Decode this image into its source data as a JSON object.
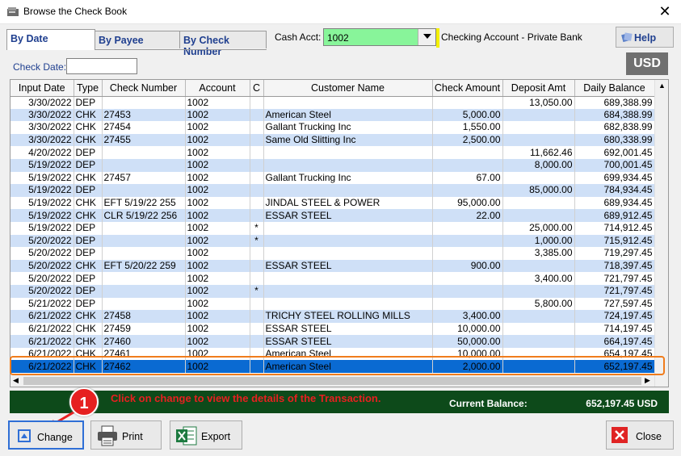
{
  "window": {
    "title": "Browse the Check Book",
    "close_glyph": "✕"
  },
  "tabs": [
    {
      "label": "By Date",
      "active": true
    },
    {
      "label": "By Payee",
      "active": false
    },
    {
      "label": "By Check Number",
      "active": false
    }
  ],
  "cash_acct": {
    "label": "Cash Acct:",
    "value": "1002",
    "account_name": "Checking Account - Private Bank"
  },
  "help": {
    "label": "Help"
  },
  "check_date": {
    "label": "Check Date:",
    "value": ""
  },
  "currency_badge": "USD",
  "grid": {
    "columns": [
      "Input Date",
      "Type",
      "Check Number",
      "Account",
      "C",
      "Customer Name",
      "Check Amount",
      "Deposit Amt",
      "Daily Balance"
    ],
    "rows": [
      [
        "3/30/2022",
        "DEP",
        "",
        "1002",
        "",
        "",
        "",
        "13,050.00",
        "689,388.99"
      ],
      [
        "3/30/2022",
        "CHK",
        "27453",
        "1002",
        "",
        "American Steel",
        "5,000.00",
        "",
        "684,388.99"
      ],
      [
        "3/30/2022",
        "CHK",
        "27454",
        "1002",
        "",
        "Gallant Trucking Inc",
        "1,550.00",
        "",
        "682,838.99"
      ],
      [
        "3/30/2022",
        "CHK",
        "27455",
        "1002",
        "",
        "Same Old Slitting Inc",
        "2,500.00",
        "",
        "680,338.99"
      ],
      [
        "4/20/2022",
        "DEP",
        "",
        "1002",
        "",
        "",
        "",
        "11,662.46",
        "692,001.45"
      ],
      [
        "5/19/2022",
        "DEP",
        "",
        "1002",
        "",
        "",
        "",
        "8,000.00",
        "700,001.45"
      ],
      [
        "5/19/2022",
        "CHK",
        "27457",
        "1002",
        "",
        "Gallant Trucking Inc",
        "67.00",
        "",
        "699,934.45"
      ],
      [
        "5/19/2022",
        "DEP",
        "",
        "1002",
        "",
        "",
        "",
        "85,000.00",
        "784,934.45"
      ],
      [
        "5/19/2022",
        "CHK",
        "EFT  5/19/22 255",
        "1002",
        "",
        "JINDAL STEEL & POWER",
        "95,000.00",
        "",
        "689,934.45"
      ],
      [
        "5/19/2022",
        "CHK",
        "CLR  5/19/22 256",
        "1002",
        "",
        " ESSAR STEEL",
        "22.00",
        "",
        "689,912.45"
      ],
      [
        "5/19/2022",
        "DEP",
        "",
        "1002",
        "*",
        "",
        "",
        "25,000.00",
        "714,912.45"
      ],
      [
        "5/20/2022",
        "DEP",
        "",
        "1002",
        "*",
        "",
        "",
        "1,000.00",
        "715,912.45"
      ],
      [
        "5/20/2022",
        "DEP",
        "",
        "1002",
        "",
        "",
        "",
        "3,385.00",
        "719,297.45"
      ],
      [
        "5/20/2022",
        "CHK",
        "EFT  5/20/22 259",
        "1002",
        "",
        " ESSAR STEEL",
        "900.00",
        "",
        "718,397.45"
      ],
      [
        "5/20/2022",
        "DEP",
        "",
        "1002",
        "",
        "",
        "",
        "3,400.00",
        "721,797.45"
      ],
      [
        "5/20/2022",
        "DEP",
        "",
        "1002",
        "*",
        "",
        "",
        "",
        "721,797.45"
      ],
      [
        "5/21/2022",
        "DEP",
        "",
        "1002",
        "",
        "",
        "",
        "5,800.00",
        "727,597.45"
      ],
      [
        "6/21/2022",
        "CHK",
        "27458",
        "1002",
        "",
        "TRICHY STEEL ROLLING MILLS",
        "3,400.00",
        "",
        "724,197.45"
      ],
      [
        "6/21/2022",
        "CHK",
        "27459",
        "1002",
        "",
        " ESSAR STEEL",
        "10,000.00",
        "",
        "714,197.45"
      ],
      [
        "6/21/2022",
        "CHK",
        "27460",
        "1002",
        "",
        " ESSAR STEEL",
        "50,000.00",
        "",
        "664,197.45"
      ],
      [
        "6/21/2022",
        "CHK",
        "27461",
        "1002",
        "",
        "American Steel",
        "10,000.00",
        "",
        "654,197.45"
      ],
      [
        "6/21/2022",
        "CHK",
        "27462",
        "1002",
        "",
        "American Steel",
        "2,000.00",
        "",
        "652,197.45"
      ]
    ],
    "selected_row": 21
  },
  "status": {
    "hint": "Click on change to view the details of the Transaction.",
    "current_balance_label": "Current Balance:",
    "current_balance_value": "652,197.45 USD"
  },
  "step_badge": "1",
  "buttons": {
    "change": "Change",
    "print": "Print",
    "export": "Export",
    "close": "Close"
  },
  "colors": {
    "accent": "#1f3f8f",
    "selected_row": "#0a6ad2",
    "alt_row": "#cfe0f7",
    "cash_field": "#88f59a",
    "status_bar": "#0d4a1a",
    "annotation": "#e62020",
    "highlight_box": "#f07c1c"
  }
}
